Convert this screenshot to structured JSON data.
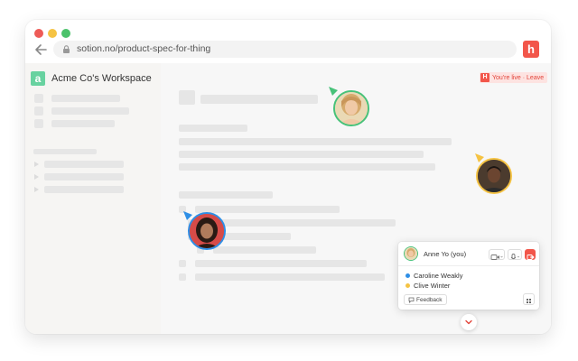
{
  "browser": {
    "url": "sotion.no/product-spec-for-thing",
    "extension_label": "h"
  },
  "workspace": {
    "logo_letter": "a",
    "name": "Acme Co's Workspace"
  },
  "live_badge": {
    "icon_letter": "H",
    "text": "You're live · Leave"
  },
  "call_panel": {
    "self_name": "Anne Yo (you)",
    "participants": [
      {
        "name": "Caroline Weakly",
        "color": "#2f8fe6"
      },
      {
        "name": "Clive Winter",
        "color": "#f5c343"
      }
    ],
    "feedback_label": "Feedback"
  },
  "colors": {
    "brand_red": "#f2564a",
    "workspace_green": "#68d2a0",
    "cursor_green": "#48c27a",
    "cursor_yellow": "#f5c343",
    "cursor_blue": "#2f8fe6"
  }
}
